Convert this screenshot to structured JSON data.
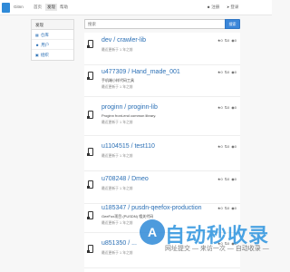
{
  "navbar": {
    "brand": "Gitnn",
    "links": [
      "首页",
      "发现",
      "帮助"
    ],
    "active_index": 1,
    "login": "注册",
    "register": "登录"
  },
  "sidebar": {
    "heading": "发现",
    "items": [
      "仓库",
      "用户",
      "组织"
    ]
  },
  "search": {
    "placeholder": "搜索",
    "button": "搜索"
  },
  "results": [
    {
      "name": "dev / crawler-lib",
      "desc": "",
      "meta": "最近更新于 1 年之前",
      "stats": [
        "0",
        "0",
        "0"
      ]
    },
    {
      "name": "u477309 / Hand_made_001",
      "desc": "手机端小样代码工具",
      "meta": "最近更新于 1 年之前",
      "stats": [
        "0",
        "0",
        "0"
      ]
    },
    {
      "name": "proginn / proginn-lib",
      "desc": "Proginn front-end common library.",
      "meta": "最近更新于 1 年之前",
      "stats": [
        "0",
        "0",
        "0"
      ]
    },
    {
      "name": "u1104515 / test110",
      "desc": "",
      "meta": "最近更新于 1 年之前",
      "stats": [
        "0",
        "0",
        "0"
      ]
    },
    {
      "name": "u708248 / Dmeo",
      "desc": "",
      "meta": "最近更新于 1 年之前",
      "stats": [
        "0",
        "0",
        "0"
      ]
    },
    {
      "name": "u185347 / pusdn-qeefox-production",
      "desc": "GeeFox项目 (PUSDN) 相关代码",
      "meta": "最近更新于 1 年之前",
      "stats": [
        "0",
        "0",
        "0"
      ]
    },
    {
      "name": "u851350 / ...",
      "desc": "",
      "meta": "最近更新于 1 年之前",
      "stats": [
        "0",
        "0",
        "0"
      ]
    }
  ],
  "watermark": {
    "logo": "A",
    "title": "自动秒收录",
    "subtitle": "网址提交 — 来访一次 — 自动收录 —"
  }
}
